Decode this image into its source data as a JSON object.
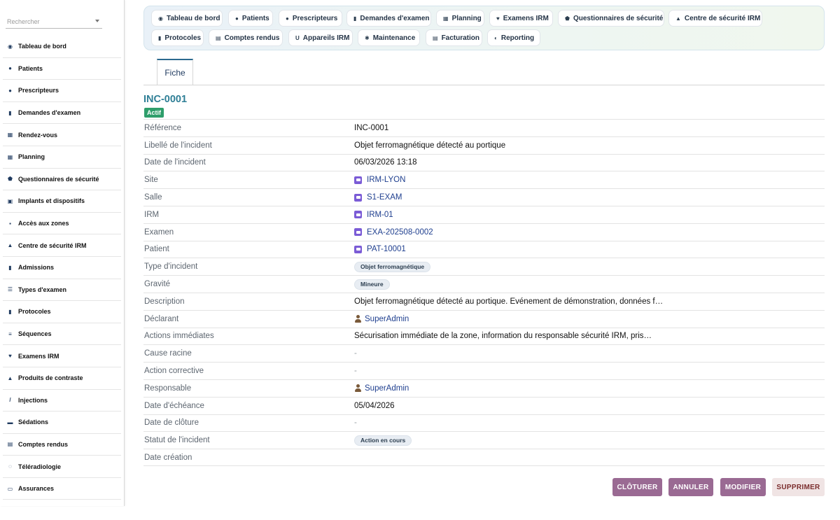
{
  "search": {
    "placeholder": "Rechercher"
  },
  "sidebar": {
    "items": [
      {
        "label": "Tableau de bord",
        "icon": "dashboard-icon"
      },
      {
        "label": "Patients",
        "icon": "user-icon"
      },
      {
        "label": "Prescripteurs",
        "icon": "doctor-icon"
      },
      {
        "label": "Demandes d'examen",
        "icon": "document-icon"
      },
      {
        "label": "Rendez-vous",
        "icon": "calendar-icon"
      },
      {
        "label": "Planning",
        "icon": "calendar-check-icon"
      },
      {
        "label": "Questionnaires de sécurité",
        "icon": "shield-icon"
      },
      {
        "label": "Implants et dispositifs",
        "icon": "cube-icon"
      },
      {
        "label": "Accès aux zones",
        "icon": "lock-icon"
      },
      {
        "label": "Centre de sécurité IRM",
        "icon": "warning-icon"
      },
      {
        "label": "Admissions",
        "icon": "clipboard-icon"
      },
      {
        "label": "Types d'examen",
        "icon": "list-icon"
      },
      {
        "label": "Protocoles",
        "icon": "file-icon"
      },
      {
        "label": "Séquences",
        "icon": "sequence-icon"
      },
      {
        "label": "Examens IRM",
        "icon": "heartbeat-icon"
      },
      {
        "label": "Produits de contraste",
        "icon": "flask-icon"
      },
      {
        "label": "Injections",
        "icon": "syringe-icon"
      },
      {
        "label": "Sédations",
        "icon": "bed-icon"
      },
      {
        "label": "Comptes rendus",
        "icon": "report-icon"
      },
      {
        "label": "Téléradiologie",
        "icon": "satellite-icon"
      },
      {
        "label": "Assurances",
        "icon": "id-card-icon"
      }
    ]
  },
  "modules": {
    "row1": [
      {
        "label": "Tableau de bord",
        "icon": "dashboard-icon"
      },
      {
        "label": "Patients",
        "icon": "user-icon"
      },
      {
        "label": "Prescripteurs",
        "icon": "doctor-icon"
      },
      {
        "label": "Demandes d'examen",
        "icon": "document-icon"
      },
      {
        "label": "Planning",
        "icon": "calendar-check-icon"
      },
      {
        "label": "Examens IRM",
        "icon": "heartbeat-icon"
      },
      {
        "label": "Questionnaires de sécurité",
        "icon": "shield-icon"
      },
      {
        "label": "Centre de sécurité IRM",
        "icon": "warning-icon"
      }
    ],
    "row2": [
      {
        "label": "Protocoles",
        "icon": "file-icon"
      },
      {
        "label": "Comptes rendus",
        "icon": "report-icon"
      },
      {
        "label": "Appareils IRM",
        "icon": "magnet-icon"
      },
      {
        "label": "Maintenance",
        "icon": "gears-icon"
      },
      {
        "label": "Facturation",
        "icon": "money-icon"
      },
      {
        "label": "Reporting",
        "icon": "chart-icon"
      }
    ]
  },
  "tabs": {
    "fiche": "Fiche"
  },
  "record": {
    "title": "INC-0001",
    "status_badge": "Actif",
    "fields": [
      {
        "label": "Référence",
        "value": "INC-0001",
        "kind": "text"
      },
      {
        "label": "Libellé de l'incident",
        "value": "Objet ferromagnétique détecté au portique",
        "kind": "text"
      },
      {
        "label": "Date de l'incident",
        "value": "06/03/2026 13:18",
        "kind": "text"
      },
      {
        "label": "Site",
        "value": "IRM-LYON",
        "kind": "record-link"
      },
      {
        "label": "Salle",
        "value": "S1-EXAM",
        "kind": "record-link"
      },
      {
        "label": "IRM",
        "value": "IRM-01",
        "kind": "record-link"
      },
      {
        "label": "Examen",
        "value": "EXA-202508-0002",
        "kind": "record-link"
      },
      {
        "label": "Patient",
        "value": "PAT-10001",
        "kind": "record-link"
      },
      {
        "label": "Type d'incident",
        "value": "Objet ferromagnétique",
        "kind": "chip"
      },
      {
        "label": "Gravité",
        "value": "Mineure",
        "kind": "chip"
      },
      {
        "label": "Description",
        "value": "Objet ferromagnétique détecté au portique. Événement de démonstration, données f…",
        "kind": "text"
      },
      {
        "label": "Déclarant",
        "value": "SuperAdmin",
        "kind": "user-link"
      },
      {
        "label": "Actions immédiates",
        "value": "Sécurisation immédiate de la zone, information du responsable sécurité IRM, pris…",
        "kind": "text"
      },
      {
        "label": "Cause racine",
        "value": "-",
        "kind": "dash"
      },
      {
        "label": "Action corrective",
        "value": "-",
        "kind": "dash"
      },
      {
        "label": "Responsable",
        "value": "SuperAdmin",
        "kind": "user-link"
      },
      {
        "label": "Date d'échéance",
        "value": "05/04/2026",
        "kind": "text"
      },
      {
        "label": "Date de clôture",
        "value": "-",
        "kind": "dash"
      },
      {
        "label": "Statut de l'incident",
        "value": "Action en cours",
        "kind": "chip"
      },
      {
        "label": "Date création",
        "value": "",
        "kind": "text"
      }
    ]
  },
  "actions": {
    "cloturer": "CLÔTURER",
    "annuler": "ANNULER",
    "modifier": "MODIFIER",
    "supprimer": "SUPPRIMER"
  },
  "colors": {
    "accent": "#2f7f96",
    "badge_actif": "#2e9e6b",
    "action_button": "#9a6a93",
    "delete_button_bg": "#f0e4e4",
    "record_icon": "#7b5cd6"
  }
}
